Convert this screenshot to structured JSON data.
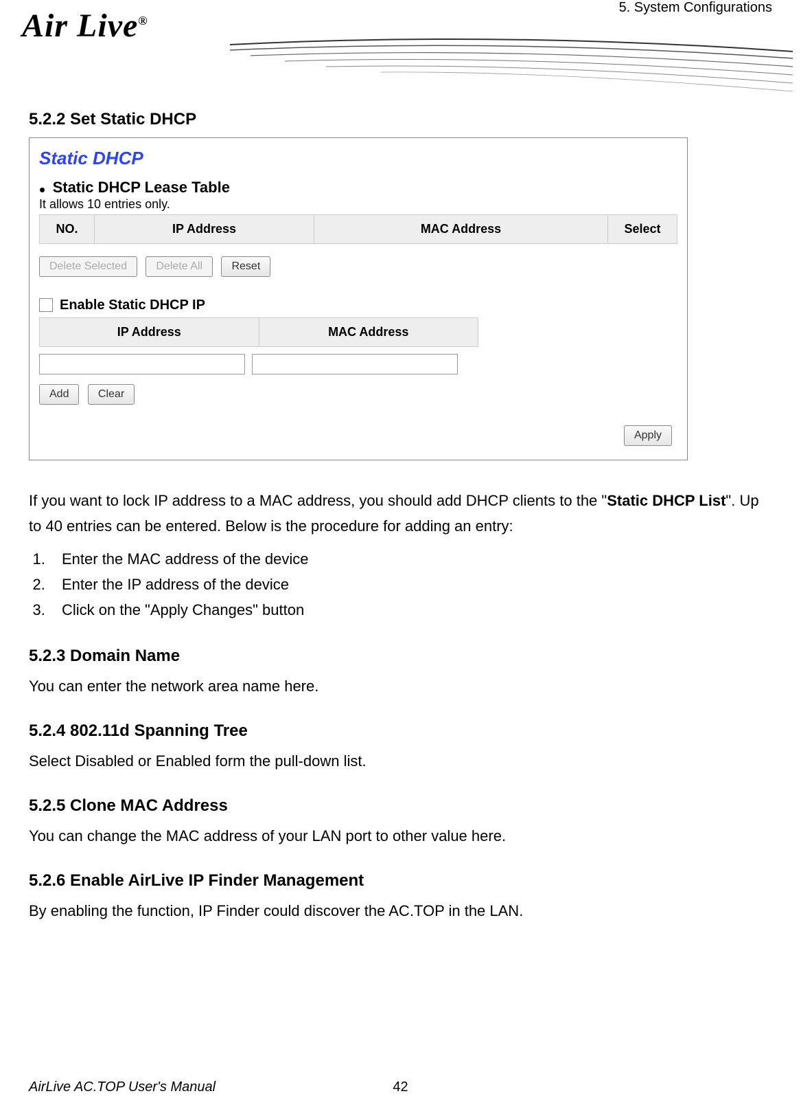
{
  "header": {
    "logo_text": "Air Live",
    "logo_reg": "®",
    "chapter": "5. System Configurations"
  },
  "section_522": {
    "heading": "5.2.2 Set Static DHCP"
  },
  "screenshot": {
    "title": "Static DHCP",
    "lease_heading": "Static DHCP Lease Table",
    "lease_note": "It allows 10 entries only.",
    "lease_cols": {
      "no": "NO.",
      "ip": "IP Address",
      "mac": "MAC Address",
      "select": "Select"
    },
    "buttons": {
      "delete_selected": "Delete Selected",
      "delete_all": "Delete All",
      "reset": "Reset",
      "add": "Add",
      "clear": "Clear",
      "apply": "Apply"
    },
    "enable_label": "Enable Static DHCP IP",
    "ipmac_cols": {
      "ip": "IP Address",
      "mac": "MAC Address"
    }
  },
  "intro": {
    "p1a": "If you want to lock IP address to a MAC address, you should add DHCP clients to the \"",
    "p1b": "Static DHCP List",
    "p1c": "\". Up to 40 entries can be entered. Below is the procedure for adding an entry:"
  },
  "steps": {
    "s1": "Enter the MAC address of the device",
    "s2": "Enter the IP address of the device",
    "s3a": "Click on the \"",
    "s3b": "Apply Changes",
    "s3c": "\" button"
  },
  "section_523": {
    "heading": "5.2.3 Domain Name",
    "desc": "You can enter the network area name here."
  },
  "section_524": {
    "heading": "5.2.4 802.11d Spanning Tree",
    "desc": "Select Disabled or Enabled form the pull-down list."
  },
  "section_525": {
    "heading": "5.2.5 Clone MAC Address",
    "desc": "You can change the MAC address of your LAN port to other value here."
  },
  "section_526": {
    "heading": "5.2.6 Enable AirLive IP Finder Management",
    "desc": "By enabling the function, IP Finder could discover the AC.TOP in the LAN."
  },
  "footer": {
    "manual": "AirLive AC.TOP User's Manual",
    "page": "42"
  }
}
